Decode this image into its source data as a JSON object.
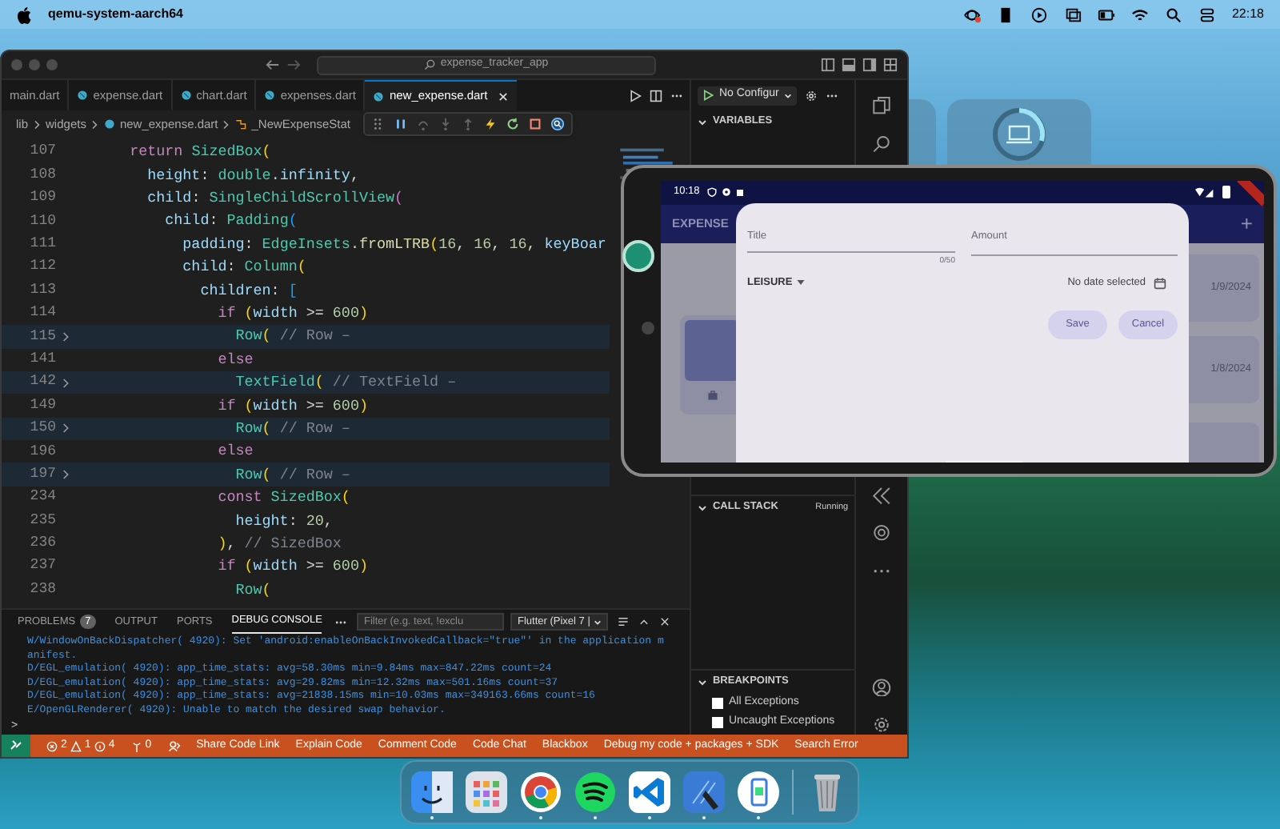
{
  "menu_bar": {
    "app_name": "qemu-system-aarch64",
    "clock": "22:18"
  },
  "editor_window": {
    "search": "expense_tracker_app",
    "tabs": [
      {
        "label": "main.dart",
        "selected": false
      },
      {
        "label": "expense.dart",
        "selected": false
      },
      {
        "label": "chart.dart",
        "selected": false
      },
      {
        "label": "expenses.dart",
        "selected": false
      },
      {
        "label": "new_expense.dart",
        "selected": true
      }
    ],
    "run_config": "No Configur",
    "breadcrumb": [
      "lib",
      "widgets",
      "new_expense.dart",
      "_NewExpenseStat"
    ],
    "code_lines": [
      {
        "number": "107",
        "folded": false,
        "tokens": [
          {
            "text": "      return ",
            "kind": "kw"
          },
          {
            "text": "SizedBox",
            "kind": "type"
          },
          {
            "text": "(",
            "kind": "br"
          }
        ]
      },
      {
        "number": "108",
        "folded": false,
        "tokens": [
          {
            "text": "        height",
            "kind": "prop"
          },
          {
            "text": ": ",
            "kind": "plain"
          },
          {
            "text": "double",
            "kind": "type"
          },
          {
            "text": ".infinity",
            "kind": "prop"
          },
          {
            "text": ",",
            "kind": "plain"
          }
        ]
      },
      {
        "number": "109",
        "folded": false,
        "tokens": [
          {
            "text": "        child",
            "kind": "prop"
          },
          {
            "text": ": ",
            "kind": "plain"
          },
          {
            "text": "SingleChildScrollView",
            "kind": "type"
          },
          {
            "text": "(",
            "kind": "br2"
          }
        ]
      },
      {
        "number": "110",
        "folded": false,
        "tokens": [
          {
            "text": "          child",
            "kind": "prop"
          },
          {
            "text": ": ",
            "kind": "plain"
          },
          {
            "text": "Padding",
            "kind": "type"
          },
          {
            "text": "(",
            "kind": "br3"
          }
        ]
      },
      {
        "number": "111",
        "folded": false,
        "tokens": [
          {
            "text": "            padding",
            "kind": "prop"
          },
          {
            "text": ": ",
            "kind": "plain"
          },
          {
            "text": "EdgeInsets",
            "kind": "type"
          },
          {
            "text": ".",
            "kind": "plain"
          },
          {
            "text": "fromLTRB",
            "kind": "fn"
          },
          {
            "text": "(",
            "kind": "br"
          },
          {
            "text": "16",
            "kind": "num"
          },
          {
            "text": ", ",
            "kind": "plain"
          },
          {
            "text": "16",
            "kind": "num"
          },
          {
            "text": ", ",
            "kind": "plain"
          },
          {
            "text": "16",
            "kind": "num"
          },
          {
            "text": ", ",
            "kind": "plain"
          },
          {
            "text": "keyBoar",
            "kind": "prop"
          }
        ]
      },
      {
        "number": "112",
        "folded": false,
        "tokens": [
          {
            "text": "            child",
            "kind": "prop"
          },
          {
            "text": ": ",
            "kind": "plain"
          },
          {
            "text": "Column",
            "kind": "type"
          },
          {
            "text": "(",
            "kind": "br"
          }
        ]
      },
      {
        "number": "113",
        "folded": false,
        "tokens": [
          {
            "text": "              children",
            "kind": "prop"
          },
          {
            "text": ": ",
            "kind": "plain"
          },
          {
            "text": "[",
            "kind": "br3"
          }
        ]
      },
      {
        "number": "114",
        "folded": false,
        "tokens": [
          {
            "text": "                if ",
            "kind": "kw"
          },
          {
            "text": "(",
            "kind": "br"
          },
          {
            "text": "width",
            "kind": "prop"
          },
          {
            "text": " >= ",
            "kind": "plain"
          },
          {
            "text": "600",
            "kind": "num"
          },
          {
            "text": ")",
            "kind": "br"
          }
        ]
      },
      {
        "number": "115",
        "folded": true,
        "tokens": [
          {
            "text": "                  Row",
            "kind": "type"
          },
          {
            "text": "(",
            "kind": "br"
          },
          {
            "text": " // Row –",
            "kind": "cm"
          }
        ]
      },
      {
        "number": "141",
        "folded": false,
        "tokens": [
          {
            "text": "                else",
            "kind": "kw"
          }
        ]
      },
      {
        "number": "142",
        "folded": true,
        "tokens": [
          {
            "text": "                  TextField",
            "kind": "type"
          },
          {
            "text": "(",
            "kind": "br"
          },
          {
            "text": " // TextField –",
            "kind": "cm"
          }
        ]
      },
      {
        "number": "149",
        "folded": false,
        "tokens": [
          {
            "text": "                if ",
            "kind": "kw"
          },
          {
            "text": "(",
            "kind": "br"
          },
          {
            "text": "width",
            "kind": "prop"
          },
          {
            "text": " >= ",
            "kind": "plain"
          },
          {
            "text": "600",
            "kind": "num"
          },
          {
            "text": ")",
            "kind": "br"
          }
        ]
      },
      {
        "number": "150",
        "folded": true,
        "tokens": [
          {
            "text": "                  Row",
            "kind": "type"
          },
          {
            "text": "(",
            "kind": "br"
          },
          {
            "text": " // Row –",
            "kind": "cm"
          }
        ]
      },
      {
        "number": "196",
        "folded": false,
        "tokens": [
          {
            "text": "                else",
            "kind": "kw"
          }
        ]
      },
      {
        "number": "197",
        "folded": true,
        "tokens": [
          {
            "text": "                  Row",
            "kind": "type"
          },
          {
            "text": "(",
            "kind": "br"
          },
          {
            "text": " // Row –",
            "kind": "cm"
          }
        ]
      },
      {
        "number": "234",
        "folded": false,
        "tokens": [
          {
            "text": "                const ",
            "kind": "kw"
          },
          {
            "text": "SizedBox",
            "kind": "type"
          },
          {
            "text": "(",
            "kind": "br"
          }
        ]
      },
      {
        "number": "235",
        "folded": false,
        "tokens": [
          {
            "text": "                  height",
            "kind": "prop"
          },
          {
            "text": ": ",
            "kind": "plain"
          },
          {
            "text": "20",
            "kind": "num"
          },
          {
            "text": ",",
            "kind": "plain"
          }
        ]
      },
      {
        "number": "236",
        "folded": false,
        "tokens": [
          {
            "text": "                )",
            "kind": "br"
          },
          {
            "text": ", ",
            "kind": "plain"
          },
          {
            "text": "// SizedBox",
            "kind": "cm"
          }
        ]
      },
      {
        "number": "237",
        "folded": false,
        "tokens": [
          {
            "text": "                if ",
            "kind": "kw"
          },
          {
            "text": "(",
            "kind": "br"
          },
          {
            "text": "width",
            "kind": "prop"
          },
          {
            "text": " >= ",
            "kind": "plain"
          },
          {
            "text": "600",
            "kind": "num"
          },
          {
            "text": ")",
            "kind": "br"
          }
        ]
      },
      {
        "number": "238",
        "folded": false,
        "tokens": [
          {
            "text": "                  Row",
            "kind": "type"
          },
          {
            "text": "(",
            "kind": "br"
          }
        ]
      }
    ],
    "panel": {
      "tabs": [
        {
          "label": "PROBLEMS",
          "badge": "7",
          "selected": false
        },
        {
          "label": "OUTPUT",
          "selected": false
        },
        {
          "label": "PORTS",
          "selected": false
        },
        {
          "label": "DEBUG CONSOLE",
          "selected": true
        }
      ],
      "filter_placeholder": "Filter (e.g. text, !exclu",
      "session": "Flutter (Pixel 7 |",
      "console_lines": [
        "W/WindowOnBackDispatcher( 4920): Set 'android:enableOnBackInvokedCallback=\"true\"' in the application m",
        "anifest.",
        "D/EGL_emulation( 4920): app_time_stats: avg=58.30ms min=9.84ms max=847.22ms count=24",
        "D/EGL_emulation( 4920): app_time_stats: avg=29.82ms min=12.32ms max=501.16ms count=37",
        "D/EGL_emulation( 4920): app_time_stats: avg=21838.15ms min=10.03ms max=349163.66ms count=16",
        "E/OpenGLRenderer( 4920): Unable to match the desired swap behavior."
      ],
      "prompt": ">"
    },
    "sidebar": {
      "variables": "VARIABLES",
      "call_stack": "CALL STACK",
      "call_stack_status": "Running",
      "breakpoints": "BREAKPOINTS",
      "breakpoint_items": [
        {
          "label": "All Exceptions",
          "checked": false
        },
        {
          "label": "Uncaught Exceptions",
          "checked": false
        }
      ]
    },
    "status_bar": {
      "errors": "2",
      "warnings": "1",
      "infos": "4",
      "ports": "0",
      "items": [
        "Share Code Link",
        "Explain Code",
        "Comment Code",
        "Code Chat",
        "Blackbox",
        "Debug my code + packages + SDK",
        "Search Error"
      ]
    }
  },
  "emulator": {
    "status_time": "10:18",
    "app_title": "EXPENSE",
    "add_button": "+",
    "dates": [
      "1/9/2024",
      "1/8/2024"
    ],
    "dialog": {
      "title_label": "Title",
      "title_counter": "0/50",
      "amount_label": "Amount",
      "category": "LEISURE",
      "date": "No date selected",
      "buttons": [
        "Save",
        "Cancel"
      ]
    }
  },
  "dock": [
    {
      "kind": "face",
      "running": true
    },
    {
      "kind": "grid",
      "running": false
    },
    {
      "kind": "ring",
      "running": true
    },
    {
      "kind": "waves",
      "running": true
    },
    {
      "kind": "chevron",
      "running": true
    },
    {
      "kind": "hammer",
      "running": true
    },
    {
      "kind": "phone",
      "running": true
    },
    {
      "kind": "trash",
      "running": false
    }
  ]
}
